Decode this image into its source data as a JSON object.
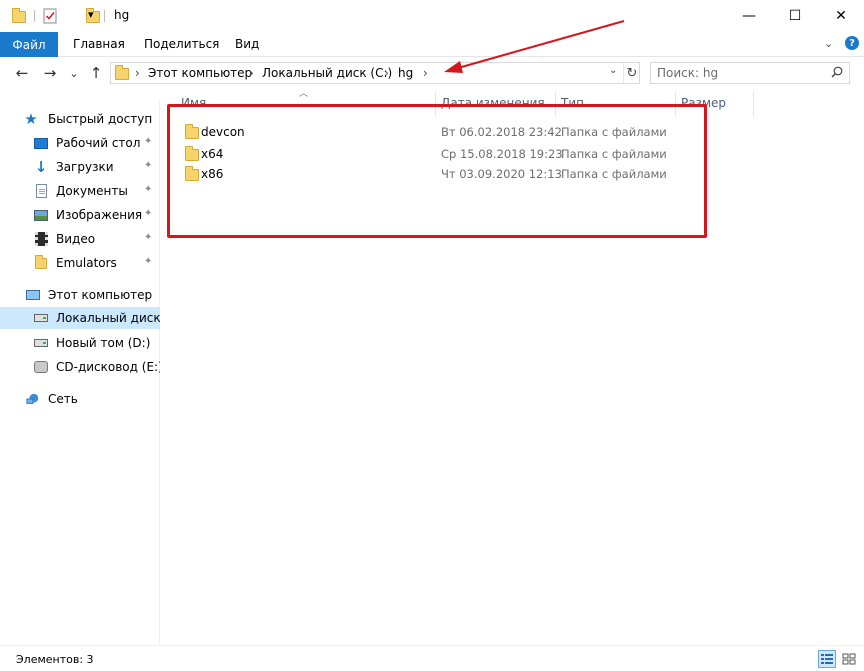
{
  "window": {
    "title": "hg",
    "quick_access_dropdown": "▾",
    "controls": {
      "minimize": "—",
      "maximize": "☐",
      "close": "✕"
    }
  },
  "ribbon": {
    "file_tab": "Файл",
    "tabs": [
      "Главная",
      "Поделиться",
      "Вид"
    ],
    "expand_glyph": "⌄",
    "help_glyph": "?"
  },
  "navigation": {
    "back": "←",
    "forward": "→",
    "recent": "⌄",
    "up": "↑"
  },
  "address": {
    "crumbs": [
      "Этот компьютер",
      "Локальный диск (C:)",
      "hg"
    ],
    "separator": "›",
    "dropdown": "⌄",
    "refresh": "↻"
  },
  "search": {
    "placeholder": "Поиск: hg",
    "icon": "search-icon"
  },
  "sidebar": {
    "items": [
      {
        "label": "Быстрый доступ",
        "icon": "star-icon",
        "pinned": false
      },
      {
        "label": "Рабочий стол",
        "icon": "desktop-icon",
        "pinned": true
      },
      {
        "label": "Загрузки",
        "icon": "download-icon",
        "pinned": true
      },
      {
        "label": "Документы",
        "icon": "document-icon",
        "pinned": true
      },
      {
        "label": "Изображения",
        "icon": "image-icon",
        "pinned": true
      },
      {
        "label": "Видео",
        "icon": "video-icon",
        "pinned": true
      },
      {
        "label": "Emulators",
        "icon": "folder-icon",
        "pinned": true
      },
      {
        "label": "Этот компьютер",
        "icon": "computer-icon",
        "pinned": false
      },
      {
        "label": "Локальный диск (C:)",
        "icon": "drive-icon",
        "pinned": false,
        "selected": true
      },
      {
        "label": "Новый том (D:)",
        "icon": "drive-icon",
        "pinned": false
      },
      {
        "label": "CD-дисковод (E:)",
        "icon": "cd-drive-icon",
        "pinned": false
      },
      {
        "label": "Сеть",
        "icon": "network-icon",
        "pinned": false
      }
    ],
    "pin_glyph": "📌"
  },
  "columns": {
    "name": "Имя",
    "date": "Дата изменения",
    "type": "Тип",
    "size": "Размер"
  },
  "files": [
    {
      "name": "devcon",
      "date": "Вт 06.02.2018 23:42",
      "type": "Папка с файлами"
    },
    {
      "name": "x64",
      "date": "Ср 15.08.2018 19:23",
      "type": "Папка с файлами"
    },
    {
      "name": "x86",
      "date": "Чт 03.09.2020 12:13",
      "type": "Папка с файлами"
    }
  ],
  "status": {
    "items_count": "Элементов: 3"
  },
  "colors": {
    "accent": "#1979ca",
    "selection": "#cce8ff",
    "annotation_red": "#d4161f"
  }
}
